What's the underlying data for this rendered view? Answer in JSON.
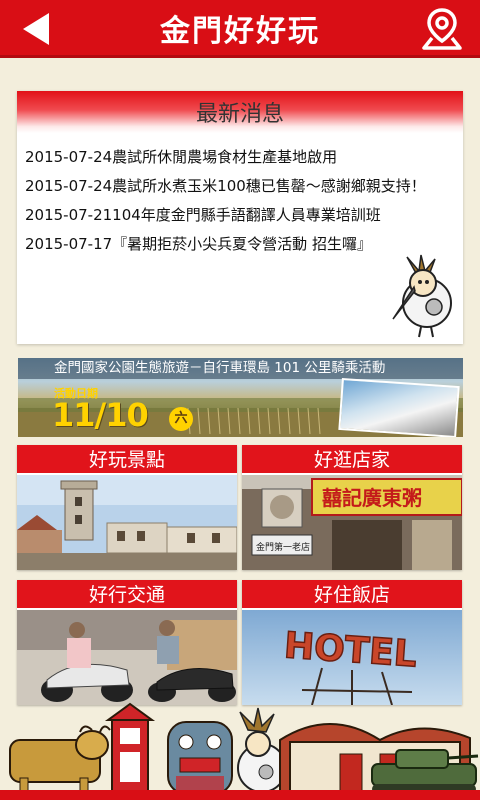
{
  "header": {
    "title": "金門好好玩",
    "back_icon": "back-arrow-icon",
    "map_icon": "map-pin-icon"
  },
  "news": {
    "title": "最新消息",
    "items": [
      "2015-07-24農試所休閒農場食材生產基地啟用",
      "2015-07-24農試所水煮玉米100穗已售罄～感謝鄉親支持！",
      "2015-07-21104年度金門縣手語翻譯人員專業培訓班",
      "2015-07-17『暑期拒菸小尖兵夏令營活動 招生囉』"
    ]
  },
  "banner": {
    "headline": "金門國家公園生態旅遊－自行車環島 101 公里騎乘活動",
    "date_label": "活動日期",
    "date": "11/10",
    "weekday": "六"
  },
  "tiles": [
    {
      "label": "好玩景點"
    },
    {
      "label": "好逛店家"
    },
    {
      "label": "好行交通"
    },
    {
      "label": "好住飯店"
    }
  ],
  "hotel_sign": "HOTEL",
  "shop_signs": {
    "store_name": "金門第一老店"
  },
  "colors": {
    "brand_red": "#d90e15",
    "background": "#f3eedc"
  }
}
